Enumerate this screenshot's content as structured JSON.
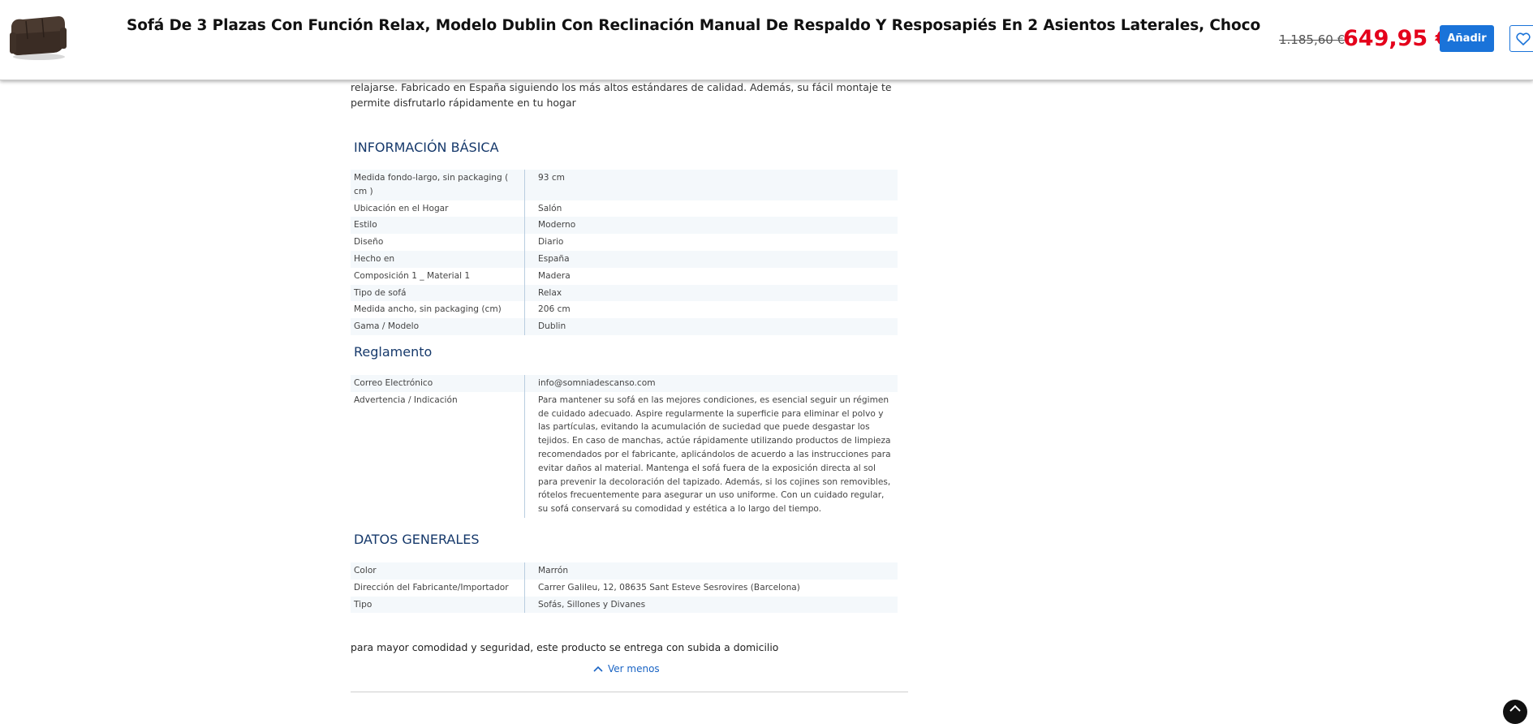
{
  "header": {
    "product_title": "Sofá De 3 Plazas Con Función Relax, Modelo Dublin Con Reclinación Manual De Respaldo Y Resposapiés En 2 Asientos Laterales, Choco",
    "old_price": "1.185,60 €",
    "price": "649,95 €",
    "add_button": "Añadir",
    "price_color": "#e4001b",
    "button_color": "#1a73d9"
  },
  "description": {
    "text": "relajarse. Fabricado en España siguiendo los más altos estándares de calidad. Además, su fácil montaje te permite disfrutarlo rápidamente en tu hogar"
  },
  "sections": [
    {
      "title": "INFORMACIÓN BÁSICA",
      "rows": [
        {
          "key": "Medida fondo-largo, sin packaging ( cm )",
          "value": "93 cm"
        },
        {
          "key": "Ubicación en el Hogar",
          "value": "Salón"
        },
        {
          "key": "Estilo",
          "value": "Moderno"
        },
        {
          "key": "Diseño",
          "value": "Diario"
        },
        {
          "key": "Hecho en",
          "value": "España"
        },
        {
          "key": "Composición 1 _ Material 1",
          "value": "Madera"
        },
        {
          "key": "Tipo de sofá",
          "value": "Relax"
        },
        {
          "key": "Medida ancho, sin packaging (cm)",
          "value": "206 cm"
        },
        {
          "key": "Gama / Modelo",
          "value": "Dublin"
        }
      ]
    },
    {
      "title": "Reglamento",
      "rows": [
        {
          "key": "Correo Electrónico",
          "value": "info@somniadescanso.com"
        },
        {
          "key": "Advertencia / Indicación",
          "value": "Para mantener su sofá en las mejores condiciones, es esencial seguir un régimen de cuidado adecuado. Aspire regularmente la superficie para eliminar el polvo y las partículas, evitando la acumulación de suciedad que puede desgastar los tejidos. En caso de manchas, actúe rápidamente utilizando productos de limpieza recomendados por el fabricante, aplicándolos de acuerdo a las instrucciones para evitar daños al material. Mantenga el sofá fuera de la exposición directa al sol para prevenir la decoloración del tapizado. Además, si los cojines son removibles, rótelos frecuentemente para asegurar un uso uniforme. Con un cuidado regular, su sofá conservará su comodidad y estética a lo largo del tiempo."
        }
      ]
    },
    {
      "title": "DATOS GENERALES",
      "rows": [
        {
          "key": "Color",
          "value": "Marrón"
        },
        {
          "key": "Dirección del Fabricante/Importador",
          "value": "Carrer Galileu, 12, 08635 Sant Esteve Sesrovires (Barcelona)"
        },
        {
          "key": "Tipo",
          "value": "Sofás, Sillones y Divanes"
        }
      ]
    }
  ],
  "footer_note": "para mayor comodidad y seguridad, este producto se entrega con subida a domicilio",
  "less_link": "Ver menos",
  "icons": {
    "favorite": "heart-icon",
    "less": "chevron-up-icon",
    "corner": "chevron-up-icon"
  }
}
